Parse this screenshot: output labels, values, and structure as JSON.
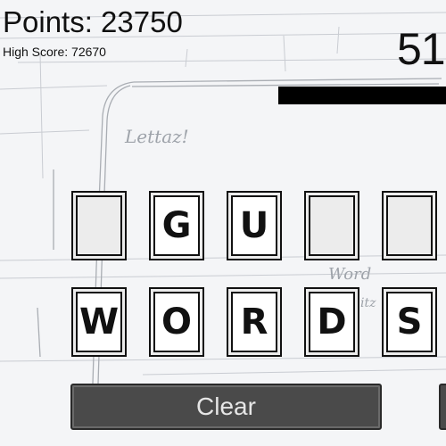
{
  "hud": {
    "points_label": "Points: 23750",
    "high_score_label": "High Score: 72670",
    "timer": "51",
    "timer_bar_fraction": 0.38
  },
  "game": {
    "top_row": [
      "",
      "G",
      "U",
      "",
      ""
    ],
    "bottom_row": [
      "W",
      "O",
      "R",
      "D",
      "S"
    ],
    "clear_label": "Clear"
  },
  "background": {
    "sketch_title": "Lettaz!",
    "sketch_word": "Word",
    "sketch_tz": "itz"
  }
}
